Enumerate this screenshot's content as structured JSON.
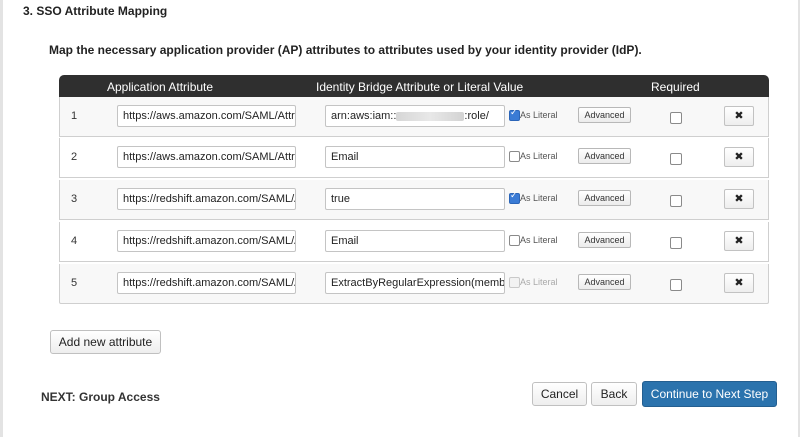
{
  "section_title": "3. SSO Attribute Mapping",
  "intro_text": "Map the necessary application provider (AP) attributes to attributes used by your identity provider (IdP).",
  "table": {
    "headers": {
      "application_attribute": "Application Attribute",
      "idp_attribute": "Identity Bridge Attribute or Literal Value",
      "required": "Required"
    },
    "literal_label": "As Literal",
    "advanced_label": "Advanced",
    "delete_icon": "✖",
    "rows": [
      {
        "num": "1",
        "app_attr": "https://aws.amazon.com/SAML/Attributes/Role",
        "idp_prefix": "arn:aws:iam::",
        "idp_suffix": ":role/",
        "literal": true,
        "literal_enabled": true,
        "required": false
      },
      {
        "num": "2",
        "app_attr": "https://aws.amazon.com/SAML/Attributes/RoleSessionName",
        "idp_value": "Email",
        "literal": false,
        "literal_enabled": true,
        "required": false
      },
      {
        "num": "3",
        "app_attr": "https://redshift.amazon.com/SAML/Attributes/AutoCreate",
        "idp_value": "true",
        "literal": true,
        "literal_enabled": true,
        "required": false
      },
      {
        "num": "4",
        "app_attr": "https://redshift.amazon.com/SAML/Attributes/DbUser",
        "idp_value": "Email",
        "literal": false,
        "literal_enabled": true,
        "required": false
      },
      {
        "num": "5",
        "app_attr": "https://redshift.amazon.com/SAML/Attributes/DbGroups",
        "idp_value": "ExtractByRegularExpression(memberOf",
        "literal": false,
        "literal_enabled": false,
        "required": false
      }
    ]
  },
  "buttons": {
    "add_attribute": "Add new attribute",
    "cancel": "Cancel",
    "back": "Back",
    "continue": "Continue to Next Step"
  },
  "next_step_label": "NEXT: Group Access",
  "colors": {
    "header_bg": "#2f2f2f",
    "primary_button": "#2b73ad",
    "checkbox_checked": "#3a7bd5"
  }
}
